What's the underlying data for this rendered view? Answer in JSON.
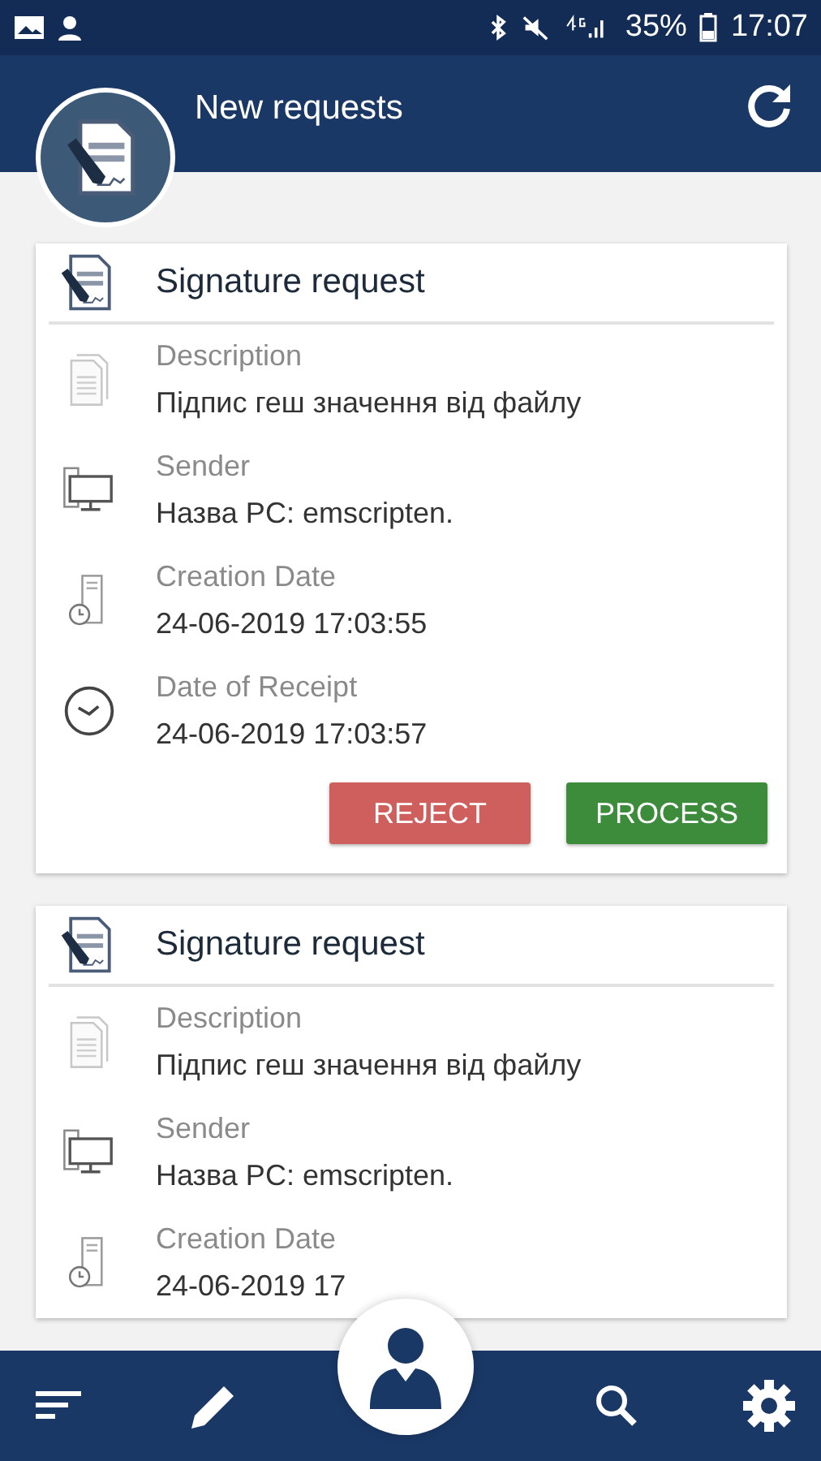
{
  "status_bar": {
    "battery": "35%",
    "time": "17:07"
  },
  "header": {
    "title": "New requests"
  },
  "cards": [
    {
      "title": "Signature request",
      "rows": [
        {
          "kind": "description",
          "label": "Description",
          "value": "Підпис геш значення від файлу"
        },
        {
          "kind": "sender",
          "label": "Sender",
          "value": "Назва PC: emscripten."
        },
        {
          "kind": "created",
          "label": "Creation Date",
          "value": "24-06-2019 17:03:55"
        },
        {
          "kind": "received",
          "label": "Date of Receipt",
          "value": "24-06-2019 17:03:57"
        }
      ],
      "buttons": [
        {
          "kind": "reject",
          "label": "REJECT"
        },
        {
          "kind": "process",
          "label": "PROCESS"
        }
      ]
    },
    {
      "title": "Signature request",
      "rows": [
        {
          "kind": "description",
          "label": "Description",
          "value": "Підпис геш значення від файлу"
        },
        {
          "kind": "sender",
          "label": "Sender",
          "value": "Назва PC: emscripten."
        },
        {
          "kind": "created",
          "label": "Creation Date",
          "value": "24-06-2019 17"
        }
      ]
    }
  ]
}
